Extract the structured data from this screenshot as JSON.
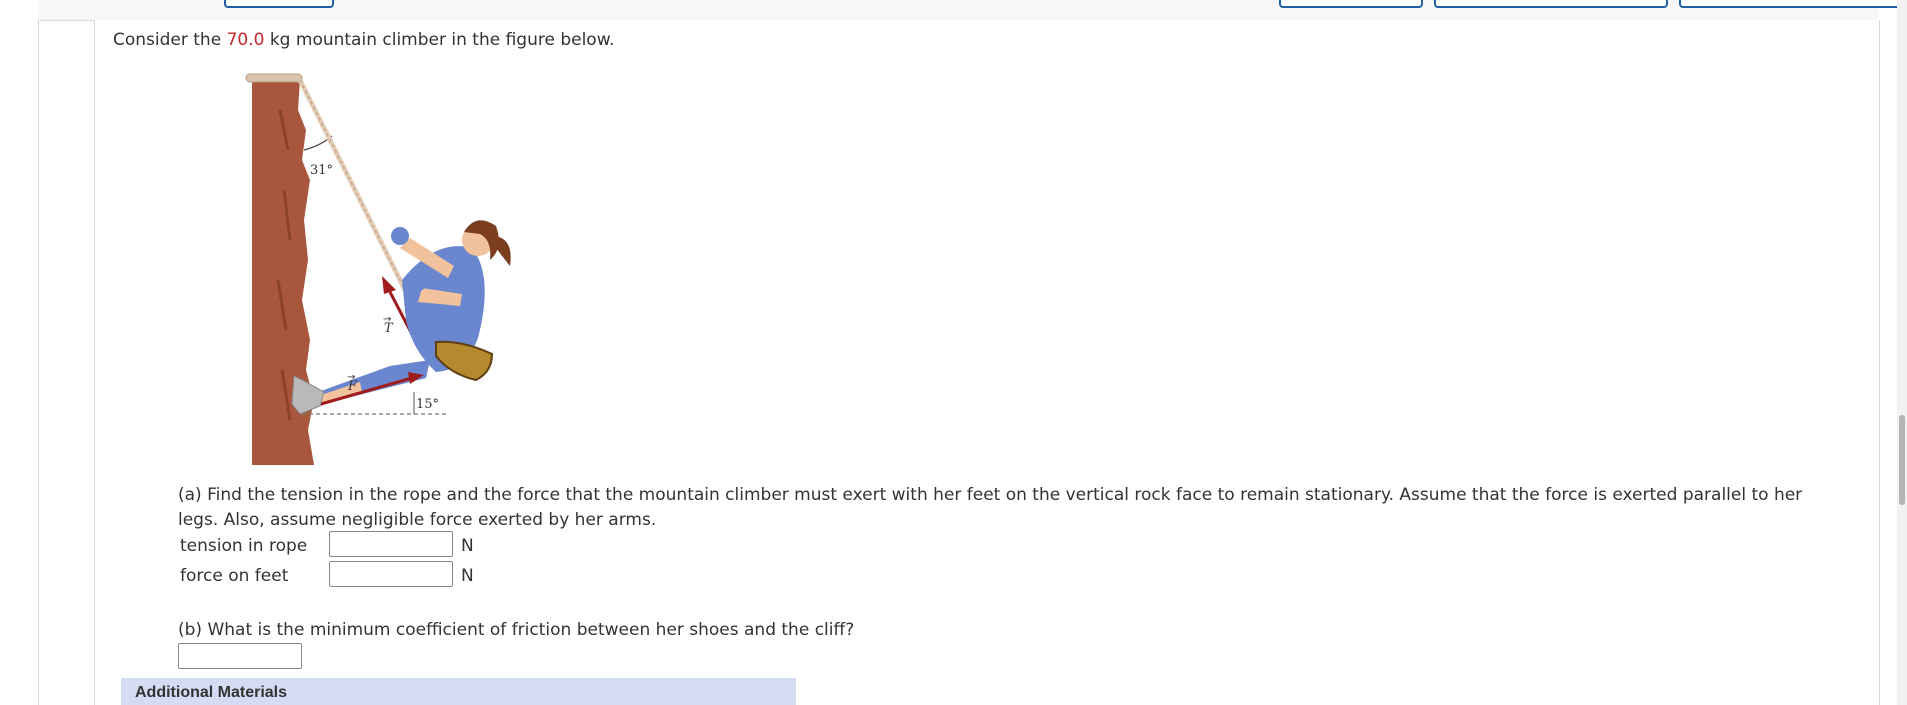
{
  "problem": {
    "intro_before": "Consider the ",
    "mass_value": "70.0",
    "intro_after": " kg mountain climber in the figure below."
  },
  "figure": {
    "rope_angle_label": "31°",
    "leg_angle_label": "15°",
    "tension_vector_label": "T",
    "force_vector_label": "F",
    "colors": {
      "rock": "#a9573c",
      "rope": "#e2cdb8",
      "suit": "#6a86cf",
      "skin": "#f2c29c",
      "hair": "#7a3e1f",
      "harness": "#7a5220",
      "vector": "#a01c1c",
      "shoe": "#b9b9b9"
    }
  },
  "part_a": {
    "question": "(a) Find the tension in the rope and the force that the mountain climber must exert with her feet on the vertical rock face to remain stationary. Assume that the force is exerted parallel to her legs. Also, assume negligible force exerted by her arms.",
    "rows": [
      {
        "label": "tension in rope",
        "value": "",
        "unit": "N"
      },
      {
        "label": "force on feet",
        "value": "",
        "unit": "N"
      }
    ]
  },
  "part_b": {
    "question": "(b) What is the minimum coefficient of friction between her shoes and the cliff?",
    "value": ""
  },
  "additional_materials": {
    "label": "Additional Materials"
  }
}
